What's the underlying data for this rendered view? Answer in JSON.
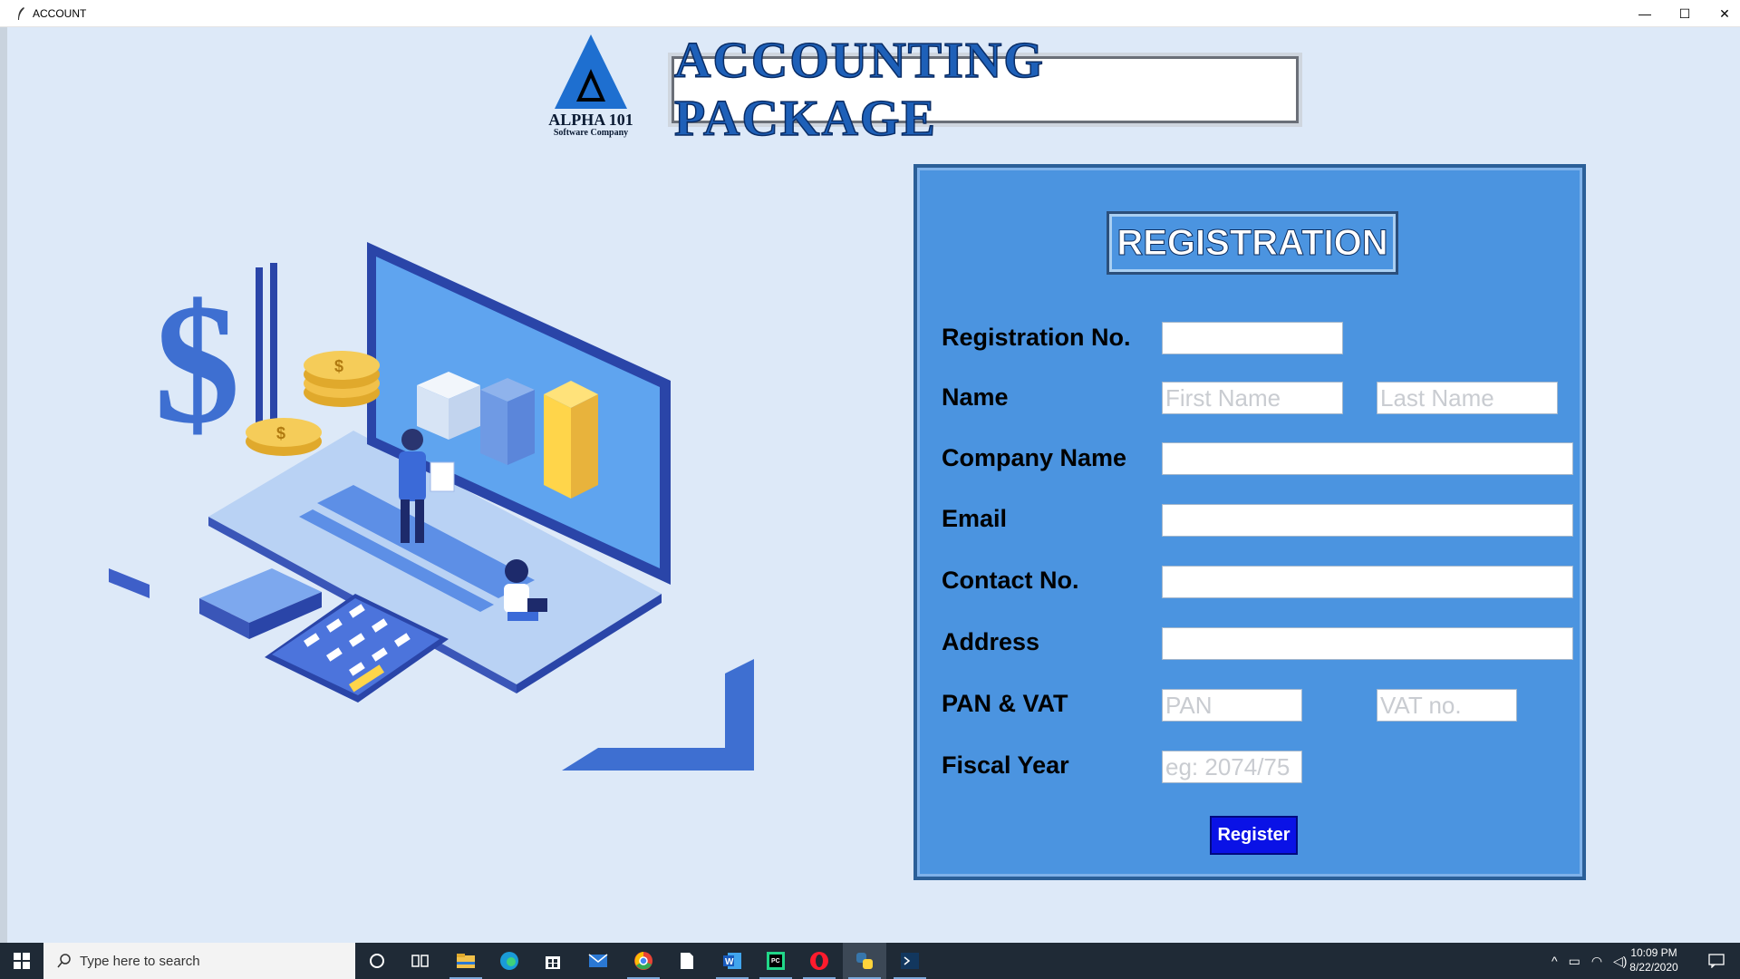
{
  "window": {
    "title": "ACCOUNT",
    "controls": {
      "minimize": "—",
      "maximize": "☐",
      "close": "✕"
    }
  },
  "logo": {
    "name": "ALPHA 101",
    "subtitle": "Software Company"
  },
  "banner": {
    "title": "ACCOUNTING PACKAGE"
  },
  "form": {
    "title": "REGISTRATION",
    "fields": {
      "registration_no": {
        "label": "Registration No.",
        "value": "",
        "placeholder": ""
      },
      "name": {
        "label": "Name",
        "first_placeholder": "First Name",
        "last_placeholder": "Last Name"
      },
      "company_name": {
        "label": "Company Name",
        "value": "",
        "placeholder": ""
      },
      "email": {
        "label": "Email",
        "value": "",
        "placeholder": ""
      },
      "contact_no": {
        "label": "Contact No.",
        "value": "",
        "placeholder": ""
      },
      "address": {
        "label": "Address",
        "value": "",
        "placeholder": ""
      },
      "pan_vat": {
        "label": "PAN & VAT",
        "pan_placeholder": "PAN",
        "vat_placeholder": "VAT no."
      },
      "fiscal_year": {
        "label": "Fiscal Year",
        "placeholder": "eg: 2074/75"
      }
    },
    "submit_label": "Register"
  },
  "taskbar": {
    "search_placeholder": "Type here to search",
    "apps": [
      "cortana-icon",
      "task-view-icon",
      "file-explorer-icon",
      "edge-icon",
      "store-icon",
      "mail-icon",
      "chrome-icon",
      "notepad-icon",
      "word-icon",
      "pycharm-icon",
      "opera-icon",
      "python-icon",
      "terminal-icon"
    ],
    "clock_time": "10:09 PM",
    "clock_date": "8/22/2020"
  },
  "colors": {
    "background": "#dde9f8",
    "panel": "#4b94e0",
    "banner_text": "#1e60b8",
    "register_button": "#0a12e6"
  }
}
